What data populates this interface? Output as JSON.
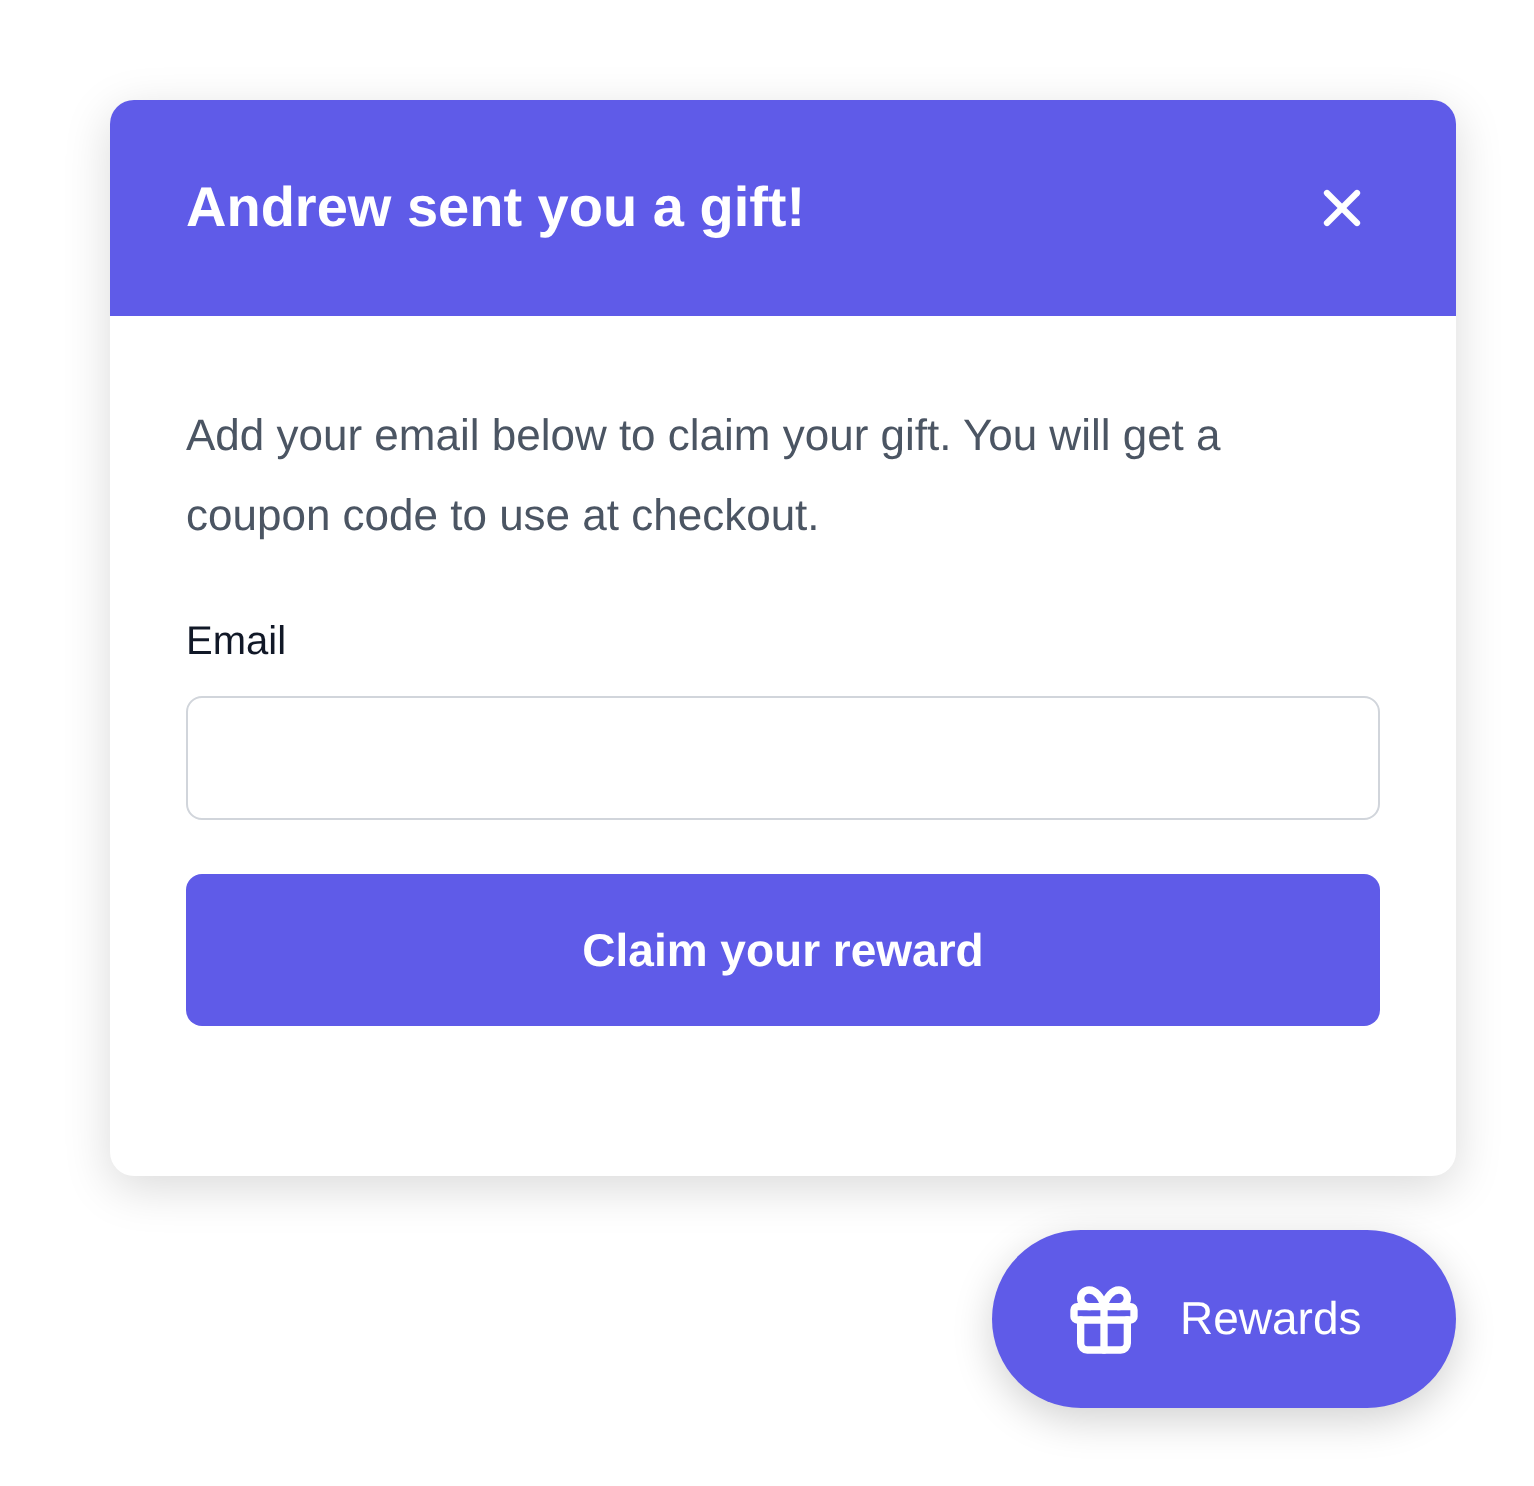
{
  "modal": {
    "title": "Andrew sent you a gift!",
    "description": "Add your email below to claim your gift. You will get a coupon code to use at checkout.",
    "email_label": "Email",
    "submit_button": "Claim your reward"
  },
  "launcher": {
    "label": "Rewards"
  }
}
